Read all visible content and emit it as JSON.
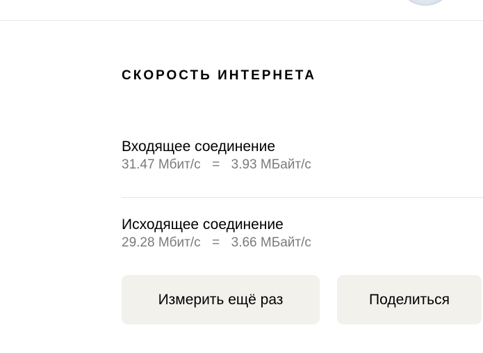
{
  "section_title": "СКОРОСТЬ ИНТЕРНЕТА",
  "incoming": {
    "label": "Входящее соединение",
    "mbit": "31.47 Мбит/с",
    "equals": "=",
    "mbyte": "3.93 МБайт/с"
  },
  "outgoing": {
    "label": "Исходящее соединение",
    "mbit": "29.28 Мбит/с",
    "equals": "=",
    "mbyte": "3.66 МБайт/с"
  },
  "buttons": {
    "measure_again": "Измерить ещё раз",
    "share": "Поделиться"
  }
}
